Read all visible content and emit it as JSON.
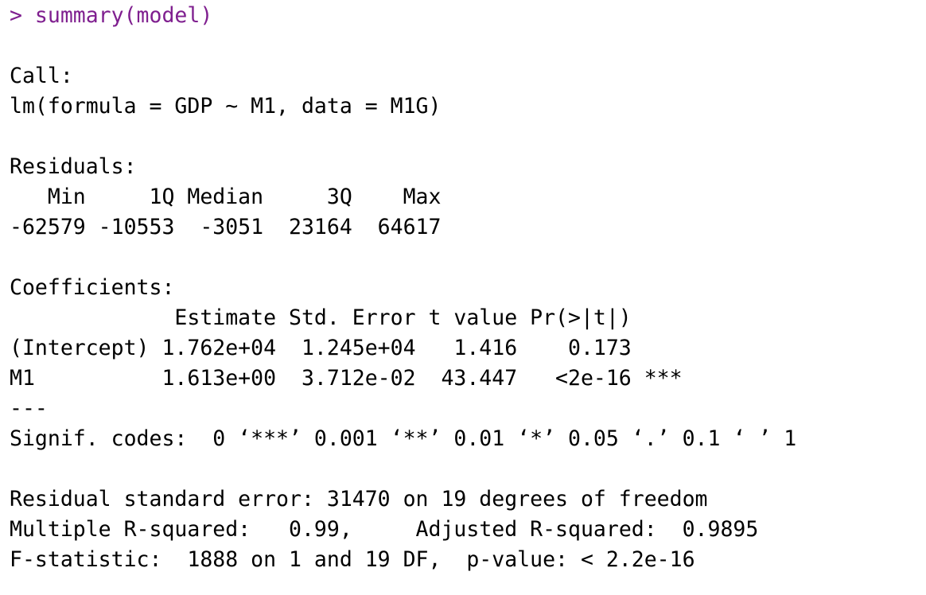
{
  "console": {
    "lines": [
      "> summary(model)",
      "",
      "Call:",
      "lm(formula = GDP ~ M1, data = M1G)",
      "",
      "Residuals:",
      "   Min     1Q Median     3Q    Max",
      "-62579 -10553  -3051  23164  64617",
      "",
      "Coefficients:",
      "             Estimate Std. Error t value Pr(>|t|)",
      "(Intercept) 1.762e+04  1.245e+04   1.416    0.173",
      "M1          1.613e+00  3.712e-02  43.447   <2e-16 ***",
      "---",
      "Signif. codes:  0 ‘***’ 0.001 ‘**’ 0.01 ‘*’ 0.05 ‘.’ 0.1 ‘ ’ 1",
      "",
      "Residual standard error: 31470 on 19 degrees of freedom",
      "Multiple R-squared:   0.99,\tAdjusted R-squared:  0.9895",
      "F-statistic:  1888 on 1 and 19 DF,  p-value: < 2.2e-16"
    ]
  },
  "colors": {
    "prompt": "#7f1f8f",
    "output": "#000000",
    "background": "#ffffff"
  }
}
